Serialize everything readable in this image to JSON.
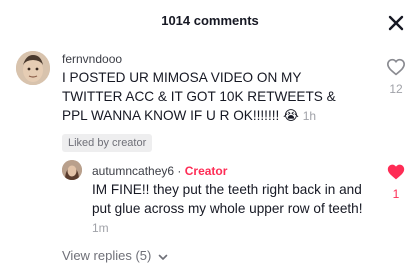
{
  "header": {
    "title": "1014 comments"
  },
  "comments": [
    {
      "username": "fernvndooo",
      "text": "I POSTED UR MIMOSA VIDEO ON MY TWITTER ACC & IT GOT 10K RETWEETS & PPL WANNA KNOW IF U R OK!!!!!!! 😭",
      "time": "1h",
      "liked_by": "Liked by creator",
      "likes": "12",
      "liked": false
    },
    {
      "username": "autumncathey6",
      "separator": " · ",
      "badge": "Creator",
      "text": "IM FINE!! they put the teeth right back in and put glue across my whole upper row of teeth!",
      "time": "1m",
      "likes": "1",
      "liked": true,
      "like_color": "#fe2c55"
    }
  ],
  "view_replies": "View replies (5)",
  "icons": {
    "close": "close-icon",
    "heart_outline": "heart-outline-icon",
    "heart_filled": "heart-filled-icon",
    "chevron": "chevron-down-icon"
  }
}
